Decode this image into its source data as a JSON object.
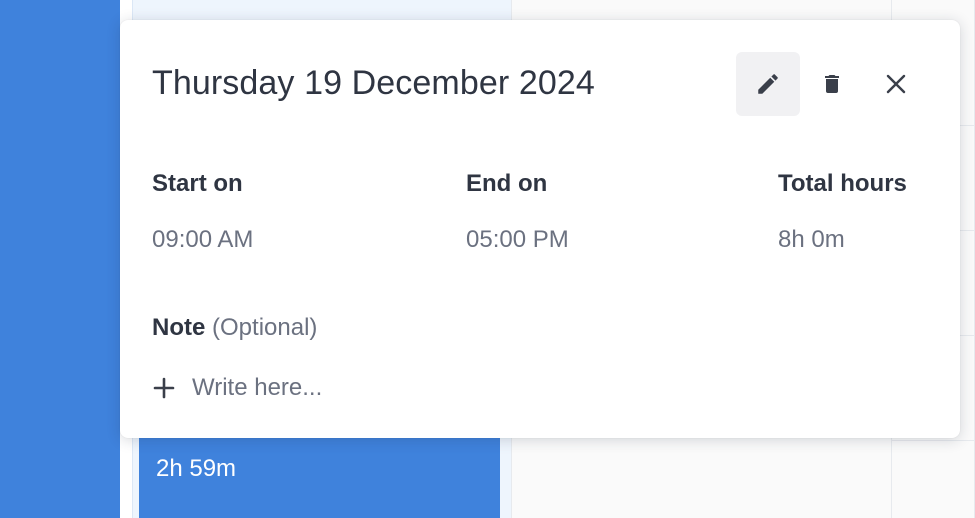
{
  "event_block": {
    "duration": "2h 59m"
  },
  "popover": {
    "title": "Thursday 19 December 2024",
    "actions": [
      {
        "name": "edit",
        "icon": "pencil-icon"
      },
      {
        "name": "delete",
        "icon": "trash-icon"
      },
      {
        "name": "close",
        "icon": "close-icon"
      }
    ],
    "fields": {
      "start": {
        "label": "Start on",
        "value": "09:00 AM"
      },
      "end": {
        "label": "End on",
        "value": "05:00 PM"
      },
      "total": {
        "label": "Total hours",
        "value": "8h 0m"
      }
    },
    "note": {
      "label": "Note",
      "optional": "(Optional)",
      "placeholder": "Write here..."
    }
  },
  "colors": {
    "accent_blue": "#3f82dc",
    "title_text": "#2f3542",
    "muted_text": "#6b7180",
    "edit_button_bg": "#f1f1f3"
  }
}
